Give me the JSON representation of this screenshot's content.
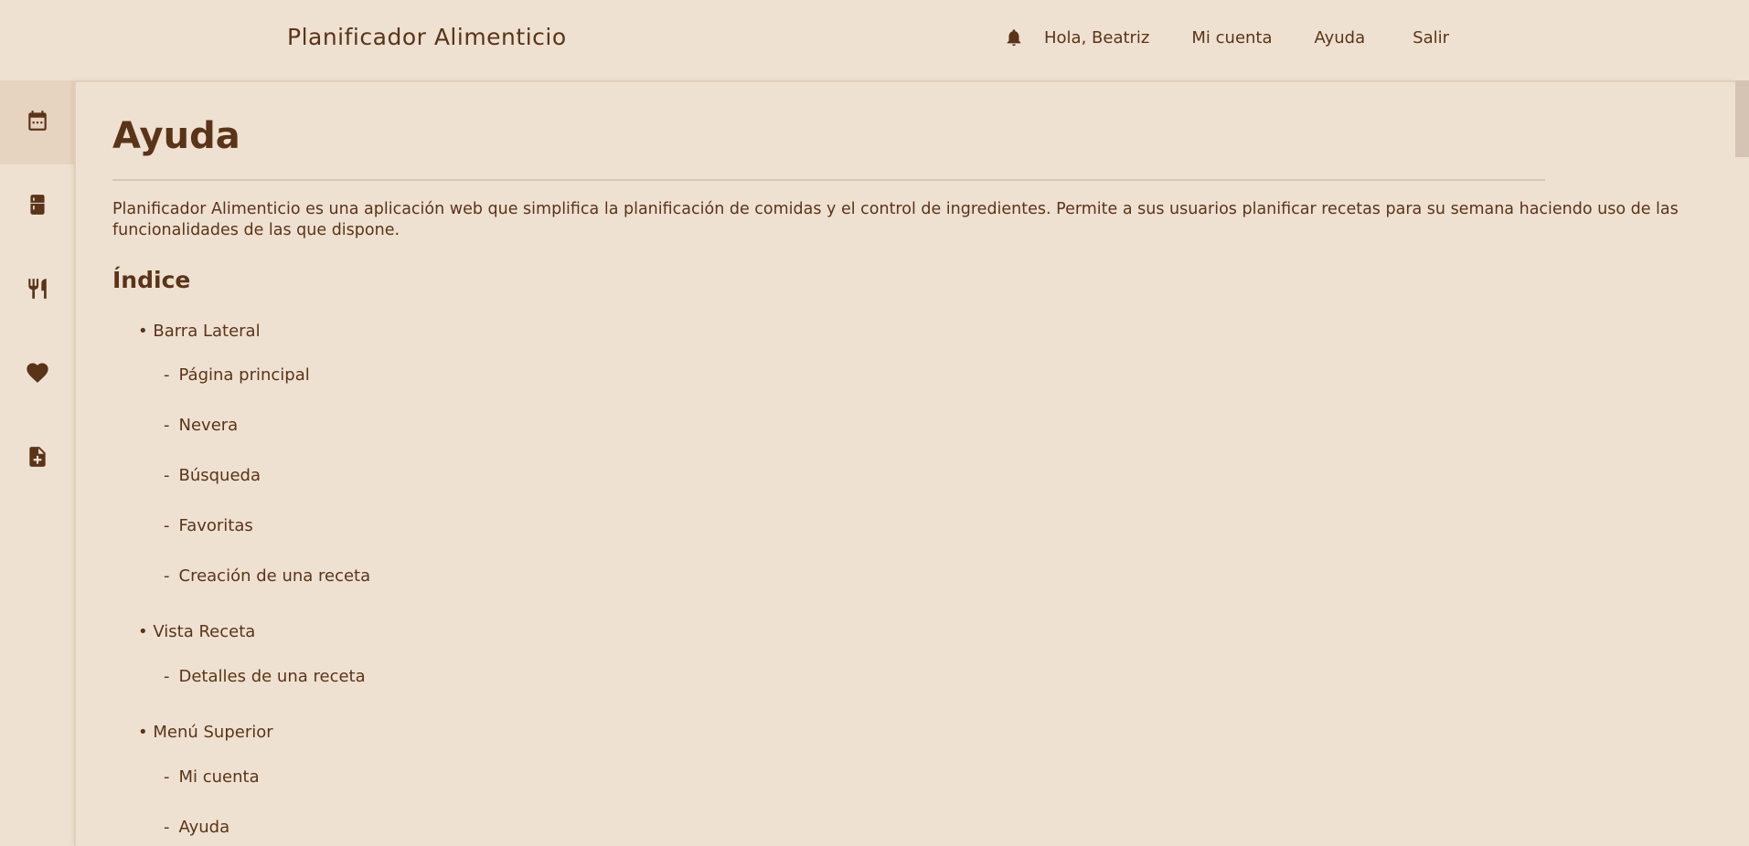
{
  "header": {
    "app_title": "Planificador Alimenticio",
    "nav": {
      "greeting": "Hola, Beatriz",
      "account": "Mi cuenta",
      "help": "Ayuda",
      "logout": "Salir"
    },
    "icons": {
      "notifications": "bell-icon"
    }
  },
  "sidebar": {
    "items": [
      {
        "icon": "calendar-icon",
        "active": true
      },
      {
        "icon": "fridge-icon",
        "active": false
      },
      {
        "icon": "fork-knife-icon",
        "active": false
      },
      {
        "icon": "heart-icon",
        "active": false
      },
      {
        "icon": "document-add-icon",
        "active": false
      }
    ]
  },
  "main": {
    "title": "Ayuda",
    "intro": "Planificador Alimenticio es una aplicación web que simplifica la planificación de comidas y el control de ingredientes. Permite a sus usuarios planificar recetas para su semana haciendo uso de las funcionalidades de las que dispone.",
    "index_title": "Índice",
    "sections": [
      {
        "label": "Barra Lateral",
        "items": [
          "Página principal",
          "Nevera",
          "Búsqueda",
          "Favoritas",
          "Creación de una receta"
        ]
      },
      {
        "label": "Vista Receta",
        "items": [
          "Detalles de una receta"
        ]
      },
      {
        "label": "Menú Superior",
        "items": [
          "Mi cuenta",
          "Ayuda"
        ]
      }
    ]
  },
  "colors": {
    "background": "#efe1d1",
    "text": "#5a3418",
    "active_sidebar": "#e6d3c0",
    "divider": "#d8c6b6"
  }
}
